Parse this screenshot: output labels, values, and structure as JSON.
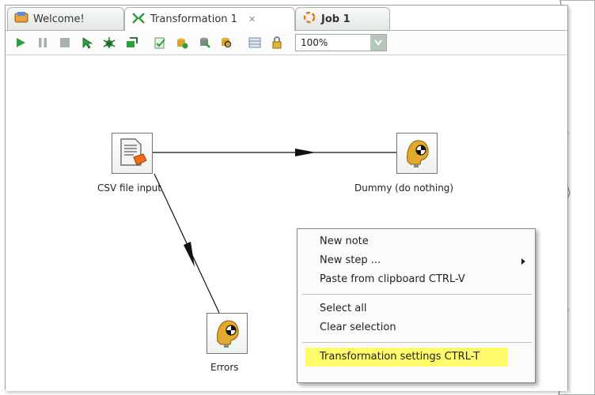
{
  "tabs": [
    {
      "label": "Welcome!",
      "icon": "welcome-icon",
      "active": false
    },
    {
      "label": "Transformation 1",
      "icon": "transformation-icon",
      "active": true,
      "close_icon": "close-icon"
    },
    {
      "label": "Job 1",
      "icon": "job-icon",
      "active": false
    }
  ],
  "toolbar": {
    "icons": [
      "run-icon",
      "pause-icon",
      "stop-icon",
      "preview-icon",
      "debug-icon",
      "replay-icon",
      "verify-icon",
      "impact-icon",
      "sql-icon",
      "explore-db-icon",
      "show-results-icon",
      "lock-icon"
    ],
    "zoom": "100%"
  },
  "steps": [
    {
      "name": "csv",
      "label": "CSV file input",
      "icon": "csv-file-input-icon"
    },
    {
      "name": "dummy",
      "label": "Dummy (do nothing)",
      "icon": "dummy-icon"
    },
    {
      "name": "errors",
      "label": "Errors",
      "icon": "dummy-icon"
    }
  ],
  "context_menu": {
    "group1": [
      "New note",
      "New step ...",
      "Paste from clipboard CTRL-V"
    ],
    "group2": [
      "Select all",
      "Clear selection"
    ],
    "group3": [
      "Transformation settings CTRL-T"
    ]
  },
  "colors": {
    "highlight": "#fffb6a",
    "accent_green": "#2f9e3f"
  }
}
